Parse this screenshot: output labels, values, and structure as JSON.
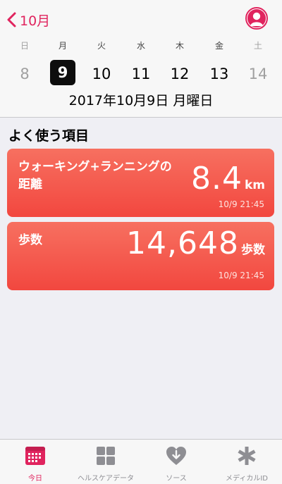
{
  "header": {
    "back_label": "10月",
    "date_title": "2017年10月9日 月曜日"
  },
  "week": {
    "days": [
      {
        "dow": "日",
        "date": "8",
        "weekend": true
      },
      {
        "dow": "月",
        "date": "9",
        "selected": true
      },
      {
        "dow": "火",
        "date": "10"
      },
      {
        "dow": "水",
        "date": "11"
      },
      {
        "dow": "木",
        "date": "12"
      },
      {
        "dow": "金",
        "date": "13"
      },
      {
        "dow": "土",
        "date": "14",
        "weekend": true
      }
    ]
  },
  "favorites": {
    "title": "よく使う項目",
    "cards": [
      {
        "label": "ウォーキング+ランニングの距離",
        "value": "8.4",
        "unit": "km",
        "time": "10/9 21:45"
      },
      {
        "label": "歩数",
        "value": "14,648",
        "unit": "歩数",
        "time": "10/9 21:45"
      }
    ]
  },
  "tabbar": {
    "tabs": [
      {
        "label": "今日",
        "icon": "calendar-icon",
        "active": true
      },
      {
        "label": "ヘルスケアデータ",
        "icon": "grid-icon"
      },
      {
        "label": "ソース",
        "icon": "heart-download-icon"
      },
      {
        "label": "メディカルID",
        "icon": "asterisk-icon"
      }
    ]
  },
  "colors": {
    "accent": "#e0245e",
    "card_top": "#f77060",
    "card_bottom": "#f2473f"
  }
}
